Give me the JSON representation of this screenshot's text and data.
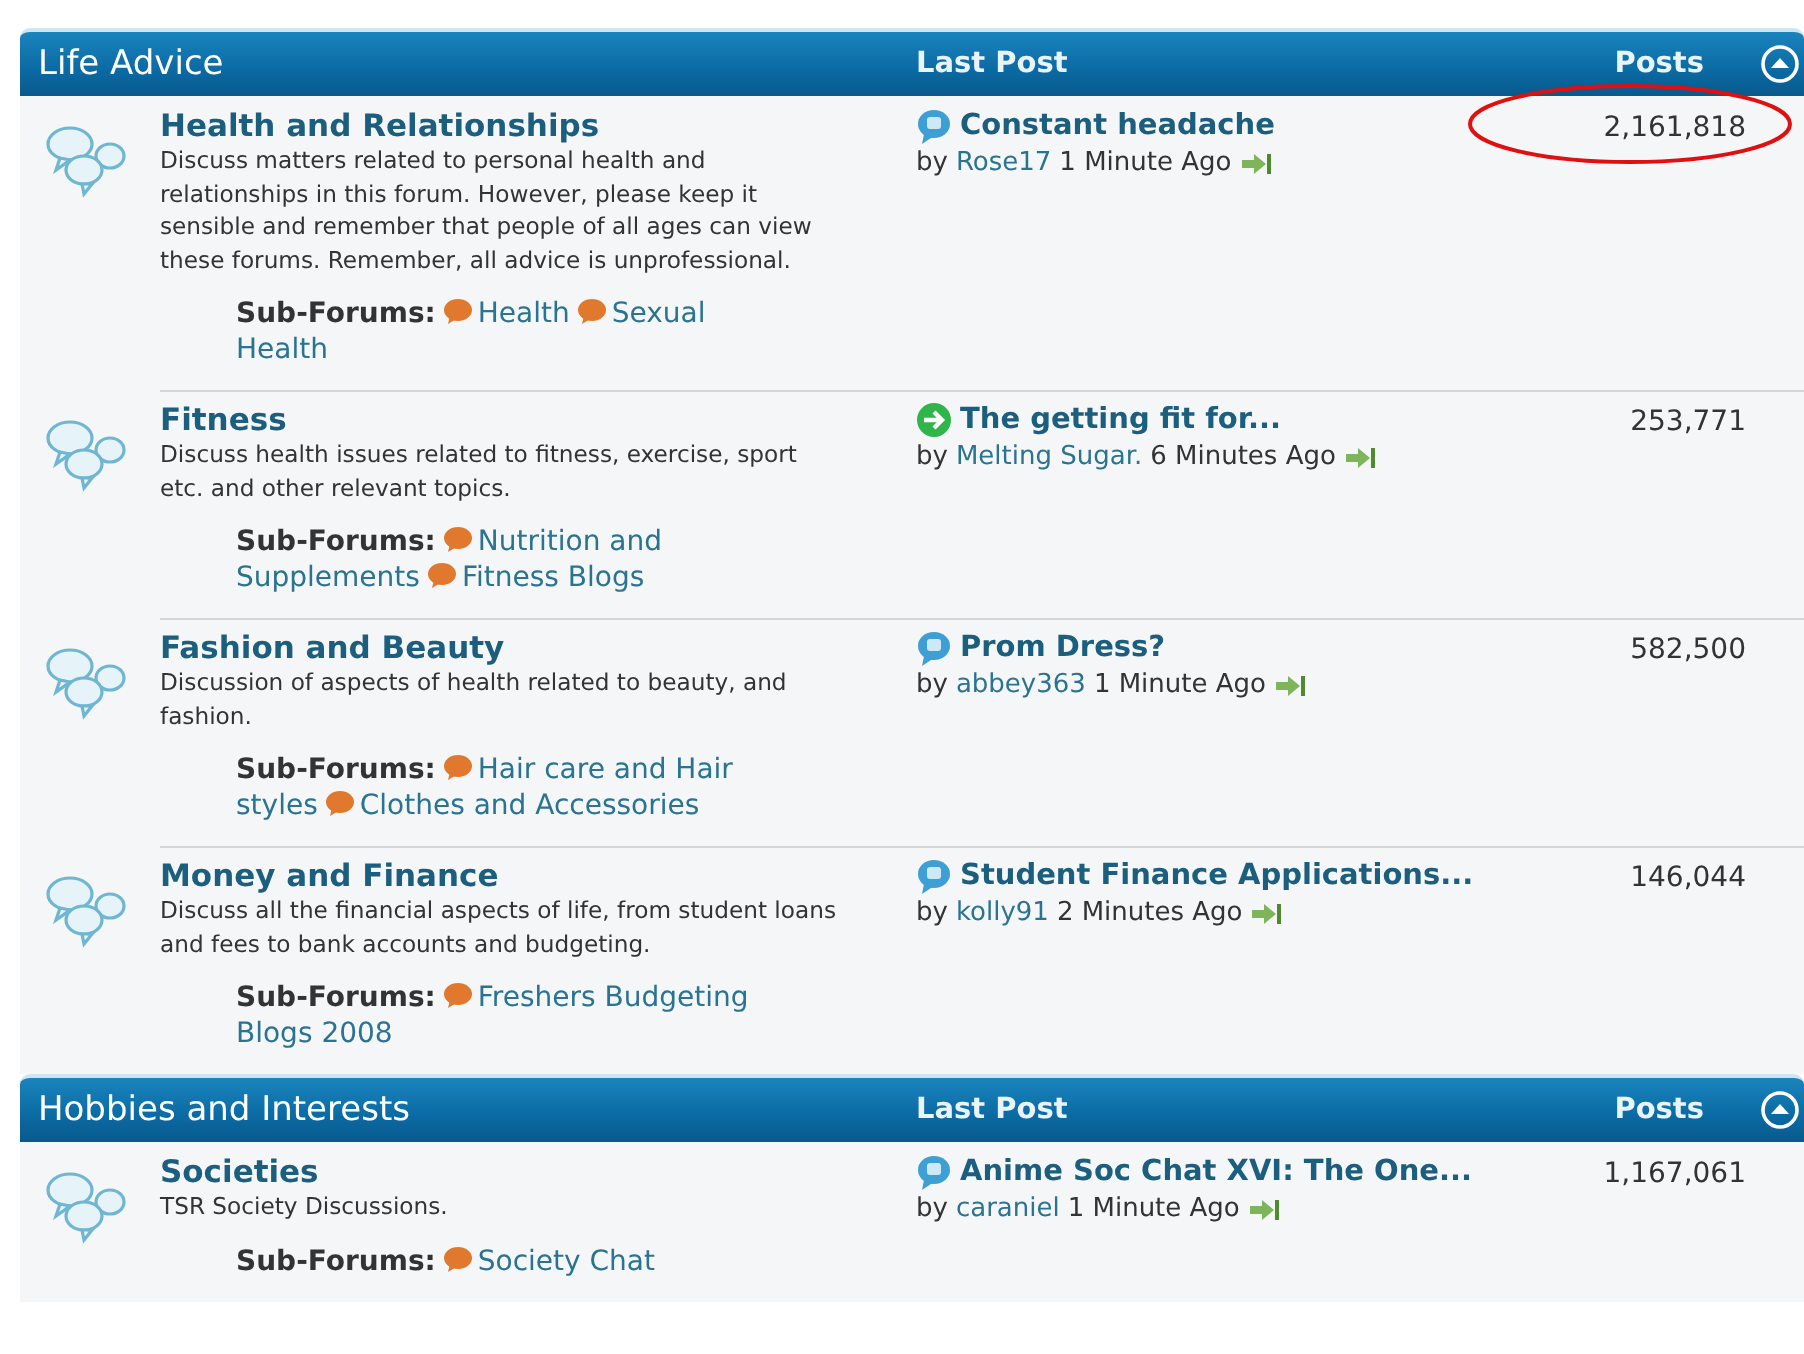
{
  "sections": [
    {
      "title": "Life Advice",
      "last_post_heading": "Last Post",
      "posts_heading": "Posts",
      "forums": [
        {
          "name": "Health and Relationships",
          "description": "Discuss matters related to personal health and relationships in this forum. However, please keep it sensible and remember that people of all ages can view these forums. Remember, all advice is unprofessional.",
          "subforums_label": "Sub-Forums:",
          "subforums": [
            "Health",
            "Sexual Health"
          ],
          "last_post": {
            "kind": "bubble",
            "title": "Constant headache",
            "by": "by",
            "author": "Rose17",
            "time": "1 Minute Ago"
          },
          "posts": "2,161,818",
          "circled": true
        },
        {
          "name": "Fitness",
          "description": "Discuss health issues related to fitness, exercise, sport etc. and other relevant topics.",
          "subforums_label": "Sub-Forums:",
          "subforums": [
            "Nutrition and Supplements",
            "Fitness Blogs"
          ],
          "last_post": {
            "kind": "arrow",
            "title": "The getting fit for...",
            "by": "by",
            "author": "Melting Sugar.",
            "time": "6 Minutes Ago"
          },
          "posts": "253,771",
          "circled": false
        },
        {
          "name": "Fashion and Beauty",
          "description": "Discussion of aspects of health related to beauty, and fashion.",
          "subforums_label": "Sub-Forums:",
          "subforums": [
            "Hair care and Hair styles",
            "Clothes and Accessories"
          ],
          "last_post": {
            "kind": "bubble",
            "title": "Prom Dress?",
            "by": "by",
            "author": "abbey363",
            "time": "1 Minute Ago"
          },
          "posts": "582,500",
          "circled": false
        },
        {
          "name": "Money and Finance",
          "description": "Discuss all the financial aspects of life, from student loans and fees to bank accounts and budgeting.",
          "subforums_label": "Sub-Forums:",
          "subforums": [
            "Freshers Budgeting Blogs 2008"
          ],
          "last_post": {
            "kind": "bubble",
            "title": "Student Finance Applications...",
            "by": "by",
            "author": "kolly91",
            "time": "2 Minutes Ago"
          },
          "posts": "146,044",
          "circled": false
        }
      ]
    },
    {
      "title": "Hobbies and Interests",
      "last_post_heading": "Last Post",
      "posts_heading": "Posts",
      "forums": [
        {
          "name": "Societies",
          "description": "TSR Society Discussions.",
          "subforums_label": "Sub-Forums:",
          "subforums": [
            "Society Chat"
          ],
          "last_post": {
            "kind": "bubble",
            "title": "Anime Soc Chat XVI: The One...",
            "by": "by",
            "author": "caraniel",
            "time": "1 Minute Ago"
          },
          "posts": "1,167,061",
          "circled": false
        }
      ]
    }
  ]
}
